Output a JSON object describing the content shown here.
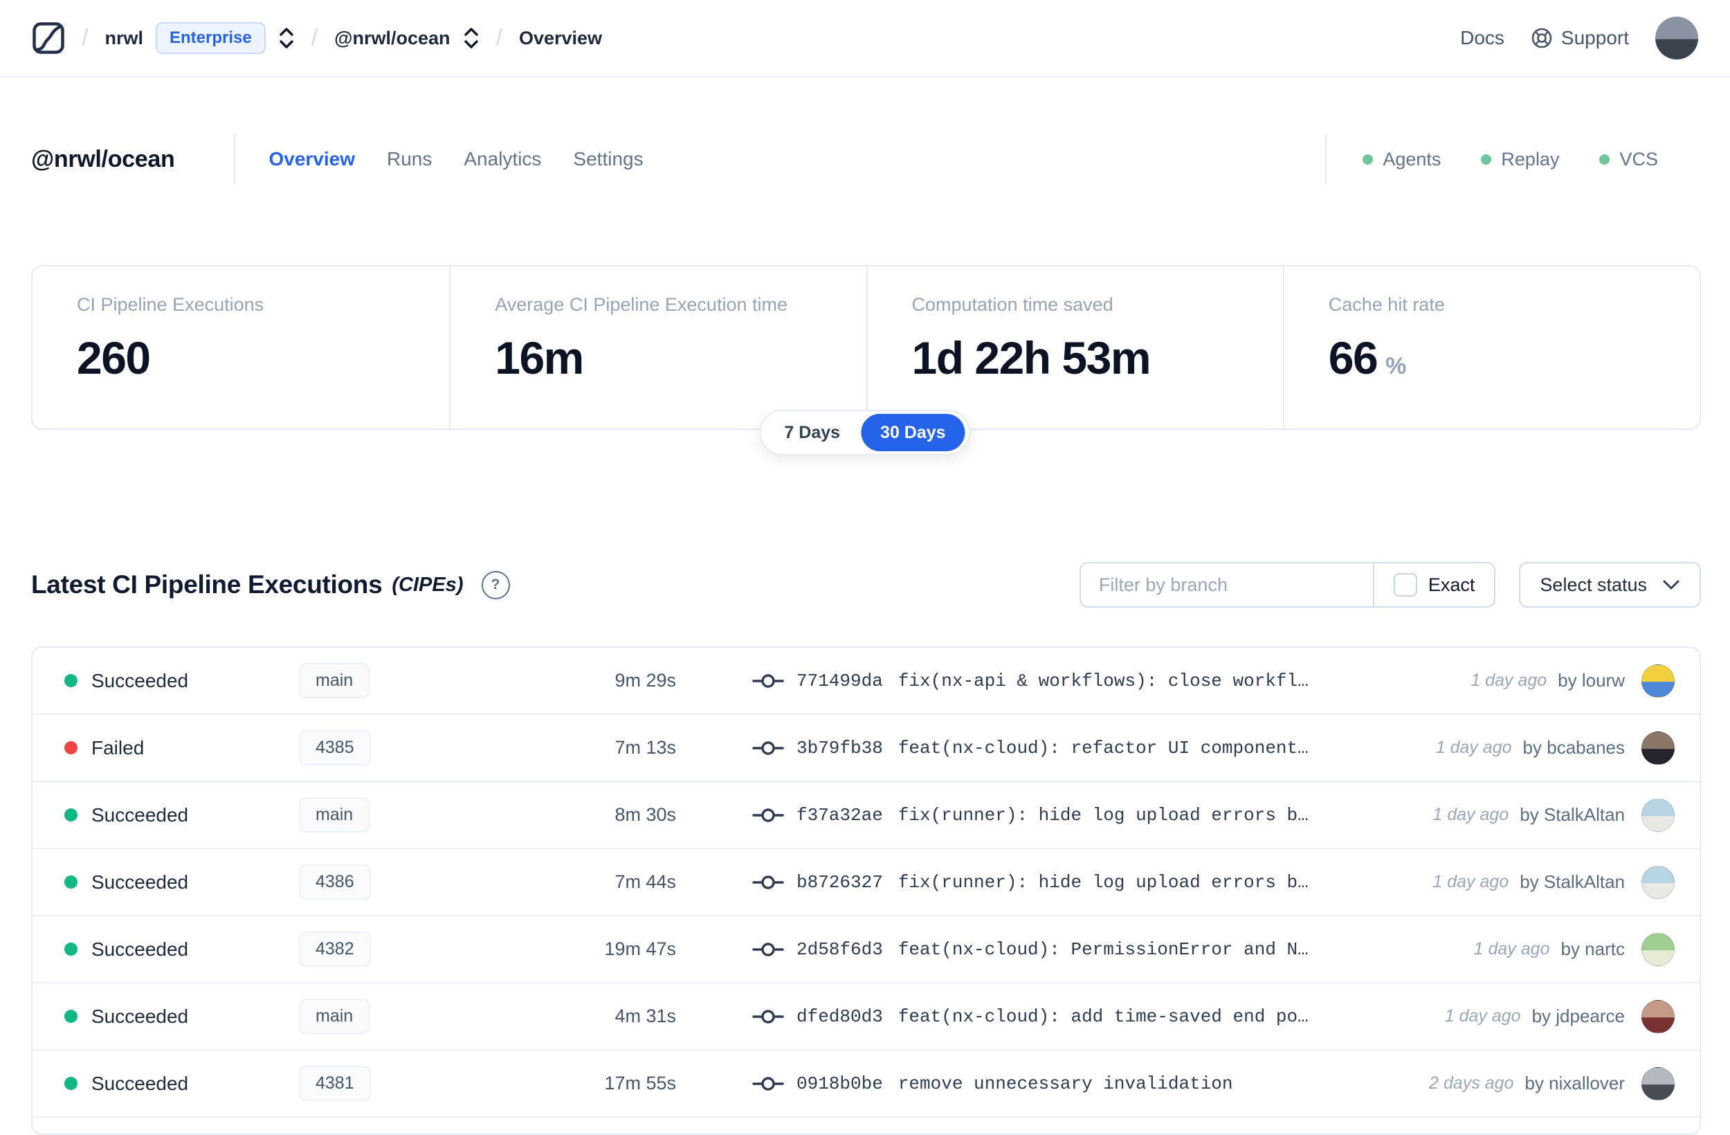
{
  "navbar": {
    "breadcrumb": {
      "org": "nrwl",
      "org_badge": "Enterprise",
      "workspace": "@nrwl/ocean",
      "page": "Overview"
    },
    "docs_label": "Docs",
    "support_label": "Support",
    "avatar_colors": [
      "#8a93a1",
      "#3a424e"
    ]
  },
  "header": {
    "title": "@nrwl/ocean",
    "tabs": [
      {
        "label": "Overview",
        "active": true
      },
      {
        "label": "Runs",
        "active": false
      },
      {
        "label": "Analytics",
        "active": false
      },
      {
        "label": "Settings",
        "active": false
      }
    ],
    "services": [
      {
        "label": "Agents"
      },
      {
        "label": "Replay"
      },
      {
        "label": "VCS"
      }
    ]
  },
  "stats": {
    "cards": [
      {
        "label": "CI Pipeline Executions",
        "value": "260"
      },
      {
        "label": "Average CI Pipeline Execution time",
        "value": "16m"
      },
      {
        "label": "Computation time saved",
        "value": "1d 22h 53m"
      },
      {
        "label": "Cache hit rate",
        "value": "66",
        "suffix": "%"
      }
    ],
    "range_toggle": {
      "options": [
        "7 Days",
        "30 Days"
      ],
      "selected": "30 Days"
    }
  },
  "cipes": {
    "title": "Latest CI Pipeline Executions",
    "subtitle": "(CIPEs)",
    "filter_placeholder": "Filter by branch",
    "exact_label": "Exact",
    "status_select_label": "Select status",
    "rows": [
      {
        "status": "Succeeded",
        "branch": "main",
        "duration": "9m 29s",
        "commit_hash": "771499da",
        "commit_message": "fix(nx-api & workflows): close workfl…",
        "ago": "1 day ago",
        "author": "by lourw",
        "avatar_colors": [
          "#f2cf3e",
          "#4f88d9"
        ]
      },
      {
        "status": "Failed",
        "branch": "4385",
        "duration": "7m 13s",
        "commit_hash": "3b79fb38",
        "commit_message": "feat(nx-cloud): refactor UI component…",
        "ago": "1 day ago",
        "author": "by bcabanes",
        "avatar_colors": [
          "#8a7566",
          "#27242d"
        ]
      },
      {
        "status": "Succeeded",
        "branch": "main",
        "duration": "8m 30s",
        "commit_hash": "f37a32ae",
        "commit_message": "fix(runner): hide log upload errors b…",
        "ago": "1 day ago",
        "author": "by StalkAltan",
        "avatar_colors": [
          "#b7d5e5",
          "#e9e9e4"
        ]
      },
      {
        "status": "Succeeded",
        "branch": "4386",
        "duration": "7m 44s",
        "commit_hash": "b8726327",
        "commit_message": "fix(runner): hide log upload errors b…",
        "ago": "1 day ago",
        "author": "by StalkAltan",
        "avatar_colors": [
          "#b7d5e5",
          "#e9e9e4"
        ]
      },
      {
        "status": "Succeeded",
        "branch": "4382",
        "duration": "19m 47s",
        "commit_hash": "2d58f6d3",
        "commit_message": "feat(nx-cloud): PermissionError and N…",
        "ago": "1 day ago",
        "author": "by nartc",
        "avatar_colors": [
          "#9ecf90",
          "#e4ecd8"
        ]
      },
      {
        "status": "Succeeded",
        "branch": "main",
        "duration": "4m 31s",
        "commit_hash": "dfed80d3",
        "commit_message": "feat(nx-cloud): add time-saved end po…",
        "ago": "1 day ago",
        "author": "by jdpearce",
        "avatar_colors": [
          "#c59a86",
          "#79322f"
        ]
      },
      {
        "status": "Succeeded",
        "branch": "4381",
        "duration": "17m 55s",
        "commit_hash": "0918b0be",
        "commit_message": "remove unnecessary invalidation",
        "ago": "2 days ago",
        "author": "by nixallover",
        "avatar_colors": [
          "#b4b9bf",
          "#474b52"
        ]
      }
    ]
  },
  "colors": {
    "accent": "#2563eb",
    "service_dot": "#6ec69a",
    "status": {
      "Succeeded": "#10b981",
      "Failed": "#ef4444"
    }
  }
}
